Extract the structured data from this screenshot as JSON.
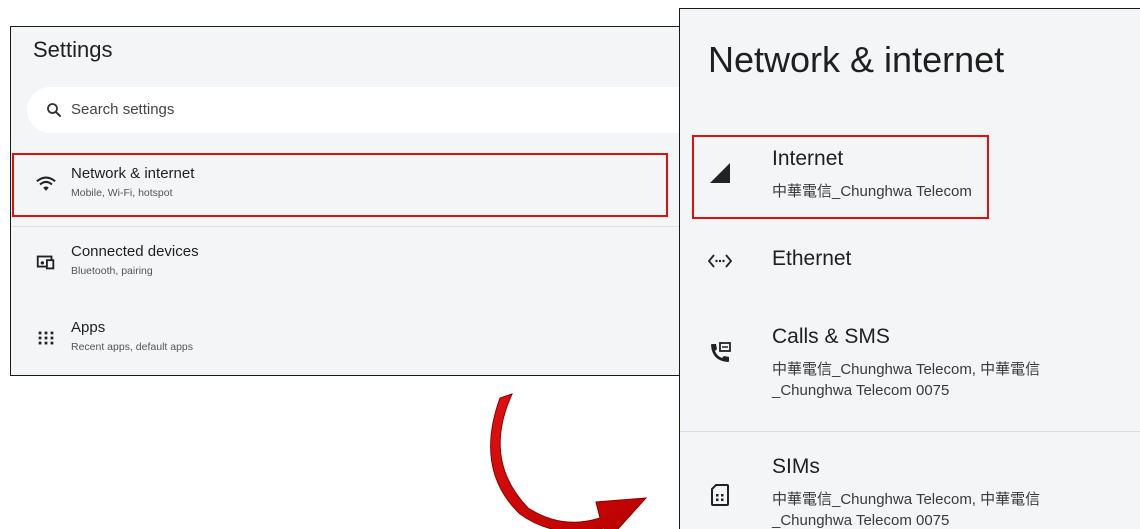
{
  "left_panel": {
    "title": "Settings",
    "search_placeholder": "Search settings",
    "items": [
      {
        "title": "Network & internet",
        "subtitle": "Mobile, Wi-Fi, hotspot",
        "icon": "wifi-icon"
      },
      {
        "title": "Connected devices",
        "subtitle": "Bluetooth, pairing",
        "icon": "connected-devices-icon"
      },
      {
        "title": "Apps",
        "subtitle": "Recent apps, default apps",
        "icon": "apps-grid-icon"
      }
    ]
  },
  "right_panel": {
    "title": "Network & internet",
    "items": [
      {
        "title": "Internet",
        "subtitle": "中華電信_Chunghwa Telecom",
        "icon": "signal-icon"
      },
      {
        "title": "Ethernet",
        "icon": "ethernet-icon"
      },
      {
        "title": "Calls & SMS",
        "subtitle": "中華電信_Chunghwa Telecom, 中華電信_Chunghwa Telecom 0075",
        "icon": "calls-sms-icon"
      },
      {
        "title": "SIMs",
        "subtitle": "中華電信_Chunghwa Telecom, 中華電信_Chunghwa Telecom 0075",
        "icon": "sim-card-icon"
      }
    ]
  },
  "colors": {
    "highlight": "#e01010",
    "arrow": "#c80000",
    "panel_bg": "#f4f5f7"
  }
}
